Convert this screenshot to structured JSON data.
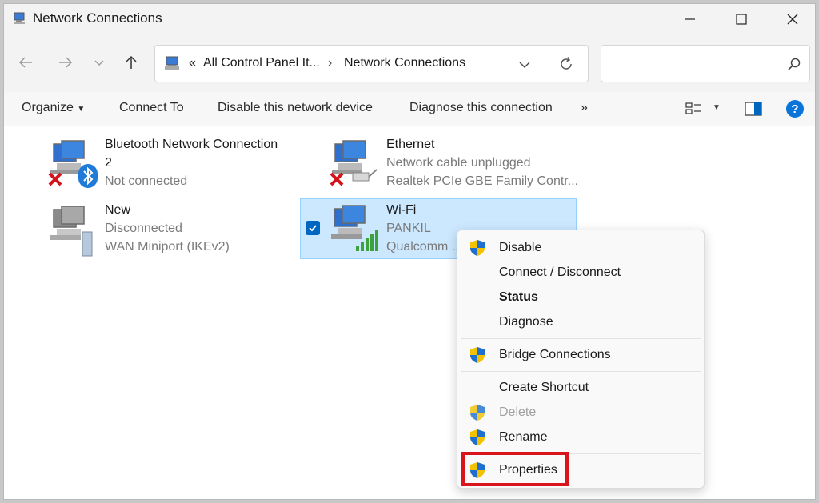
{
  "window": {
    "title": "Network Connections"
  },
  "address": {
    "overflow": "«",
    "crumb1": "All Control Panel It...",
    "sep": "›",
    "crumb2": "Network Connections"
  },
  "search": {
    "placeholder": ""
  },
  "toolbar": {
    "organize": "Organize",
    "connect_to": "Connect To",
    "disable": "Disable this network device",
    "diagnose": "Diagnose this connection",
    "more": "»"
  },
  "connections": [
    {
      "name": "Bluetooth Network Connection",
      "name2": "2",
      "status": "Not connected",
      "device": ""
    },
    {
      "name": "Ethernet",
      "status": "Network cable unplugged",
      "device": "Realtek PCIe GBE Family Contr..."
    },
    {
      "name": "New",
      "status": "Disconnected",
      "device": "WAN Miniport (IKEv2)"
    },
    {
      "name": "Wi-Fi",
      "status": "PANKIL",
      "device": "Qualcomm ..."
    }
  ],
  "context_menu": {
    "disable": "Disable",
    "connect_disconnect": "Connect / Disconnect",
    "status": "Status",
    "diagnose": "Diagnose",
    "bridge": "Bridge Connections",
    "create_shortcut": "Create Shortcut",
    "delete": "Delete",
    "rename": "Rename",
    "properties": "Properties"
  },
  "colors": {
    "accent": "#0067c0",
    "highlight": "#d9141b",
    "selection": "#cce8ff"
  }
}
